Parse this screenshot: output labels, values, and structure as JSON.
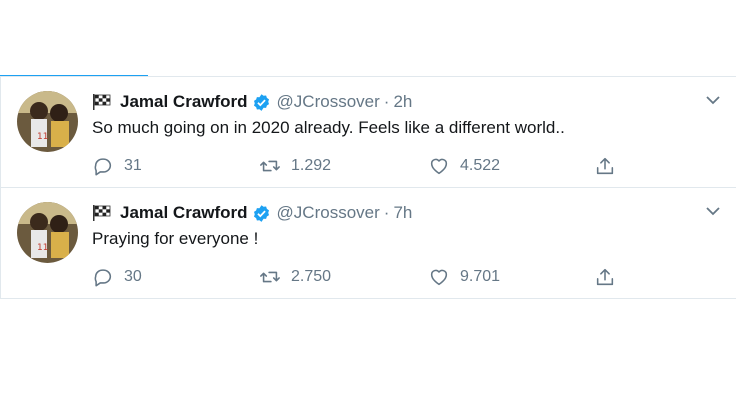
{
  "tweets": [
    {
      "name": "Jamal Crawford",
      "handle": "@JCrossover",
      "separator": "·",
      "time": "2h",
      "text": "So much going on in 2020 already. Feels like a different world..",
      "replies": "31",
      "retweets": "1.292",
      "likes": "4.522"
    },
    {
      "name": "Jamal Crawford",
      "handle": "@JCrossover",
      "separator": "·",
      "time": "7h",
      "text": "Praying for everyone !",
      "replies": "30",
      "retweets": "2.750",
      "likes": "9.701"
    }
  ],
  "icons": {
    "name_emoji": "checkered-flag-icon",
    "verified": "verified-badge-icon",
    "menu": "chevron-down-icon",
    "reply": "reply-icon",
    "retweet": "retweet-icon",
    "like": "heart-icon",
    "share": "share-icon"
  },
  "colors": {
    "accent": "#1da1f2",
    "muted": "#657786",
    "text": "#14171a",
    "divider": "#e1e8ed"
  }
}
